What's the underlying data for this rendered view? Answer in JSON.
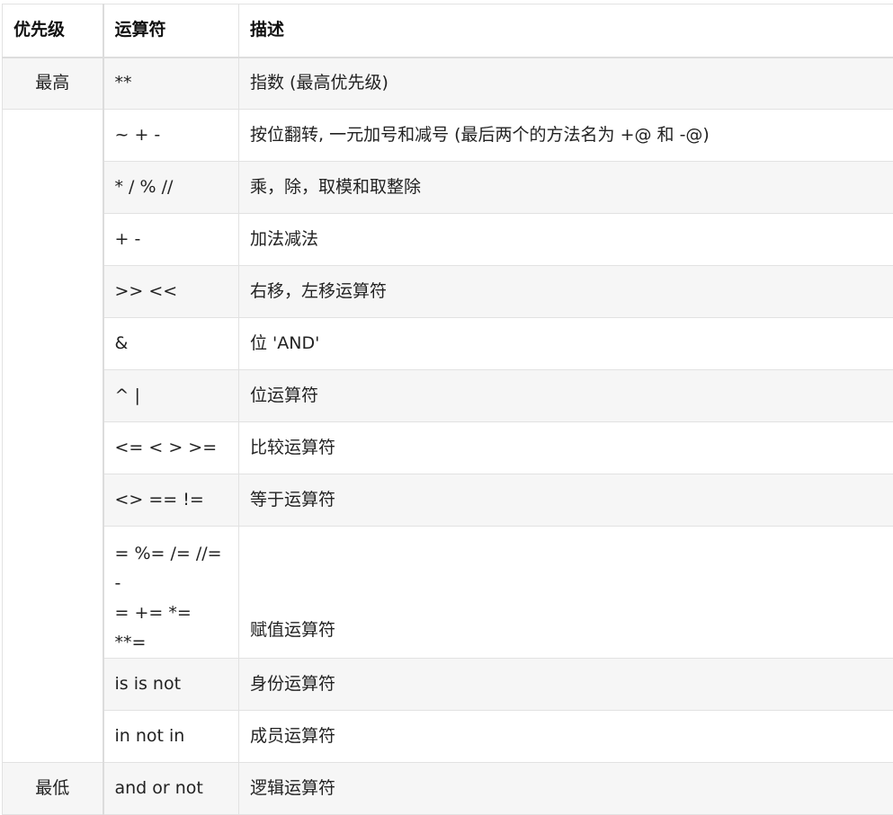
{
  "table": {
    "headers": [
      "优先级",
      "运算符",
      "描述"
    ],
    "rows": [
      {
        "precedence": "最高",
        "operator": "**",
        "description": "指数 (最高优先级)"
      },
      {
        "precedence": "",
        "operator": "~ + -",
        "description": "按位翻转, 一元加号和减号 (最后两个的方法名为 +@ 和 -@)"
      },
      {
        "precedence": "",
        "operator": "* / % //",
        "description": "乘，除，取模和取整除"
      },
      {
        "precedence": "",
        "operator": "+ -",
        "description": "加法减法"
      },
      {
        "precedence": "",
        "operator": ">> <<",
        "description": "右移，左移运算符"
      },
      {
        "precedence": "",
        "operator": "&",
        "description": "位 'AND'"
      },
      {
        "precedence": "",
        "operator": "^ |",
        "description": "位运算符"
      },
      {
        "precedence": "",
        "operator": "<= < > >=",
        "description": "比较运算符"
      },
      {
        "precedence": "",
        "operator": "<> == !=",
        "description": "等于运算符"
      },
      {
        "precedence": "",
        "operator_lines": [
          "= %= /= //= -",
          "= += *= **="
        ],
        "description": "赋值运算符"
      },
      {
        "precedence": "",
        "operator": "is is not",
        "description": "身份运算符"
      },
      {
        "precedence": "",
        "operator": "in not in",
        "description": "成员运算符"
      },
      {
        "precedence": "最低",
        "operator": "and or not",
        "description": "逻辑运算符"
      }
    ]
  },
  "colors": {
    "border": "#e2e2e2",
    "alt_row_bg": "#f6f6f6",
    "text": "#222222"
  }
}
